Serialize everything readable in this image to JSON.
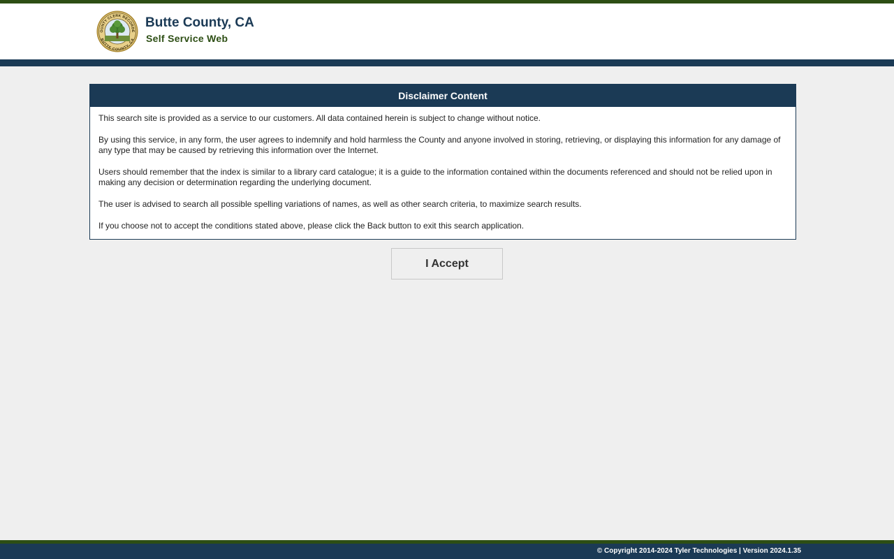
{
  "header": {
    "title": "Butte County, CA",
    "subtitle": "Self Service Web",
    "seal": {
      "top_text": "COUNTY CLERK RECORDER",
      "bottom_text": "BUTTE COUNTY, CA"
    }
  },
  "disclaimer": {
    "heading": "Disclaimer Content",
    "paragraphs": [
      "This search site is provided as a service to our customers. All data contained herein is subject to change without notice.",
      "By using this service, in any form, the user agrees to indemnify and hold harmless the County and anyone involved in storing, retrieving, or displaying this information for any damage of any type that may be caused by retrieving this information over the Internet.",
      "Users should remember that the index is similar to a library card catalogue; it is a guide to the information contained within the documents referenced and should not be relied upon in making any decision or determination regarding the underlying document.",
      "The user is advised to search all possible spelling variations of names, as well as other search criteria, to maximize search results.",
      "If you choose not to accept the conditions stated above, please click the Back button to exit this search application."
    ]
  },
  "accept_button": {
    "label": "I Accept"
  },
  "footer": {
    "copyright": "© Copyright 2014-2024 Tyler Technologies | Version 2024.1.35"
  },
  "colors": {
    "navy": "#1b3a55",
    "green": "#2d4e14",
    "background": "#efefef"
  }
}
